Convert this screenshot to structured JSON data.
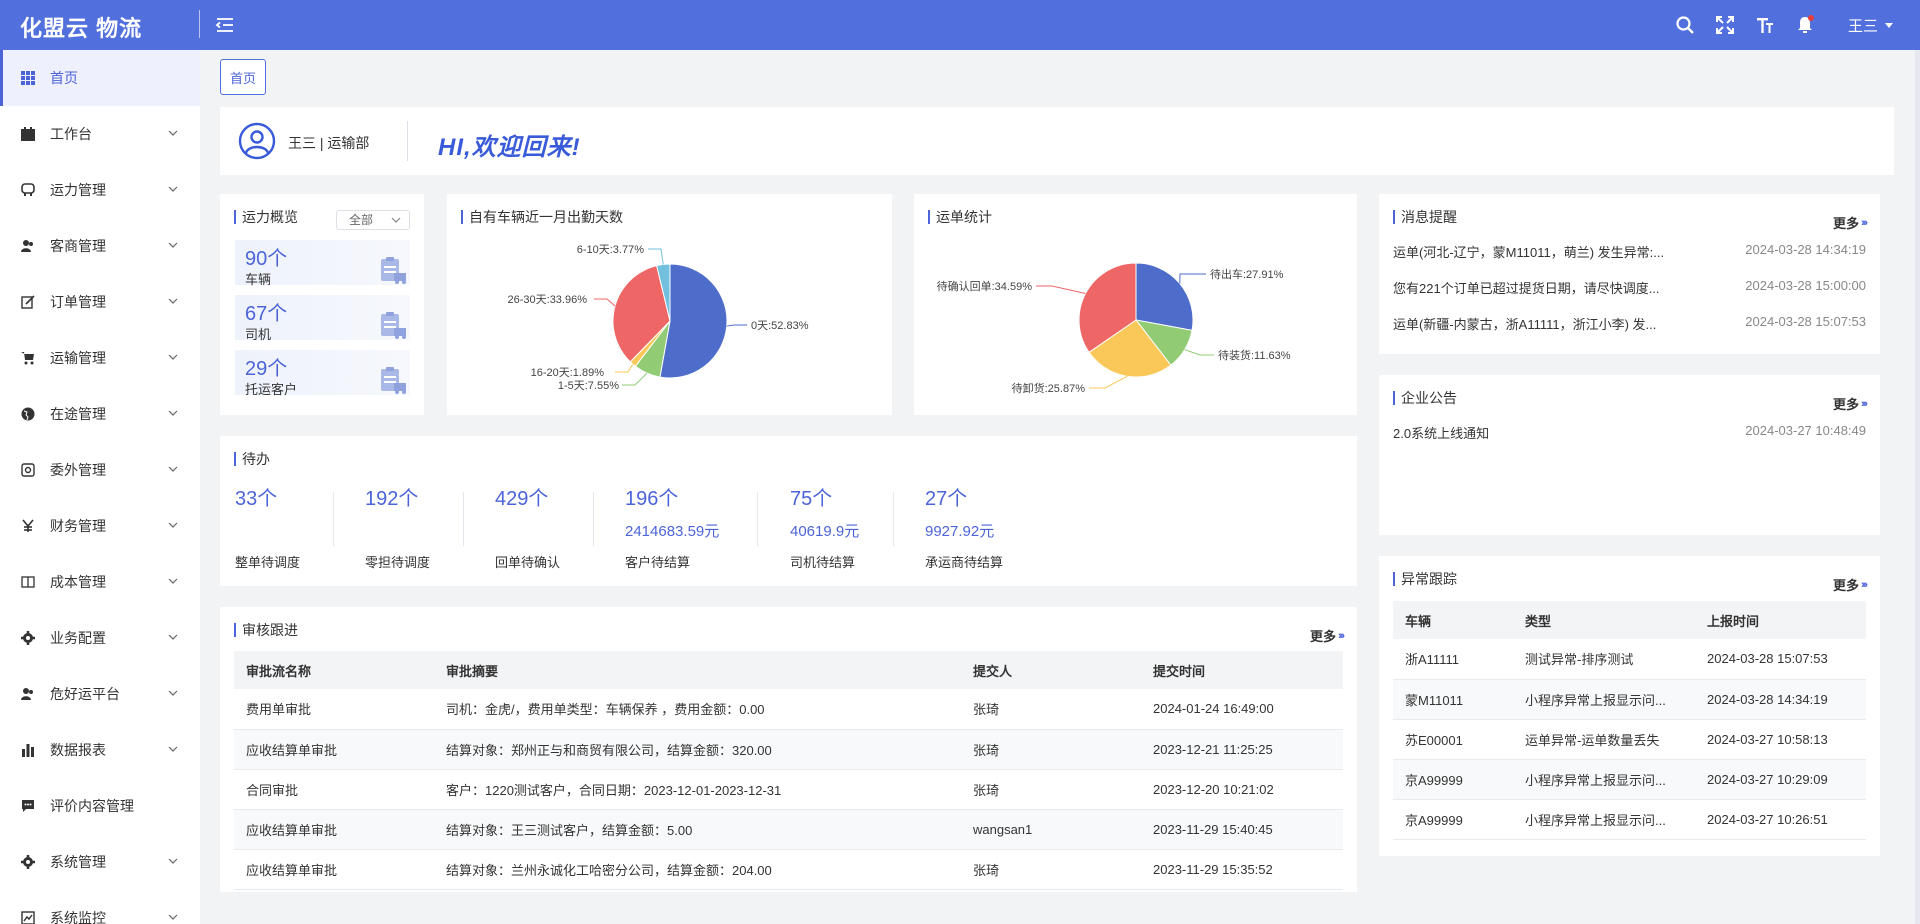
{
  "app": {
    "title": "化盟云 物流"
  },
  "header": {
    "user_name": "王三"
  },
  "sidebar": {
    "items": [
      {
        "label": "首页",
        "icon": "grid-icon"
      },
      {
        "label": "工作台",
        "icon": "calendar-icon"
      },
      {
        "label": "运力管理",
        "icon": "vehicle-icon"
      },
      {
        "label": "客商管理",
        "icon": "users-icon"
      },
      {
        "label": "订单管理",
        "icon": "edit-icon"
      },
      {
        "label": "运输管理",
        "icon": "cart-icon"
      },
      {
        "label": "在途管理",
        "icon": "globe-icon"
      },
      {
        "label": "委外管理",
        "icon": "outsource-icon"
      },
      {
        "label": "财务管理",
        "icon": "yen-icon"
      },
      {
        "label": "成本管理",
        "icon": "book-icon"
      },
      {
        "label": "业务配置",
        "icon": "gear-icon"
      },
      {
        "label": "危好运平台",
        "icon": "user-group-icon"
      },
      {
        "label": "数据报表",
        "icon": "bar-chart-icon"
      },
      {
        "label": "评价内容管理",
        "icon": "comment-icon"
      },
      {
        "label": "系统管理",
        "icon": "settings-icon"
      },
      {
        "label": "系统监控",
        "icon": "monitor-icon"
      }
    ]
  },
  "tabs": {
    "home": "首页"
  },
  "welcome": {
    "user": "王三 | 运输部",
    "greeting": "HI,欢迎回来!"
  },
  "capacity": {
    "title": "运力概览",
    "filter": "全部",
    "items": [
      {
        "value": "90个",
        "label": "车辆"
      },
      {
        "value": "67个",
        "label": "司机"
      },
      {
        "value": "29个",
        "label": "托运客户"
      }
    ]
  },
  "attendance": {
    "title": "自有车辆近一月出勤天数",
    "chart_data": {
      "type": "pie",
      "slices": [
        {
          "label": "0天:52.83%",
          "value": 52.83,
          "color": "#4e6cc9"
        },
        {
          "label": "1-5天:7.55%",
          "value": 7.55,
          "color": "#91cc75"
        },
        {
          "label": "16-20天:1.89%",
          "value": 1.89,
          "color": "#fac858"
        },
        {
          "label": "26-30天:33.96%",
          "value": 33.96,
          "color": "#ee6666"
        },
        {
          "label": "6-10天:3.77%",
          "value": 3.77,
          "color": "#73c0de"
        }
      ]
    }
  },
  "waybill": {
    "title": "运单统计",
    "chart_data": {
      "type": "pie",
      "slices": [
        {
          "label": "待出车:27.91%",
          "value": 27.91,
          "color": "#4e6cc9"
        },
        {
          "label": "待装货:11.63%",
          "value": 11.63,
          "color": "#91cc75"
        },
        {
          "label": "待卸货:25.87%",
          "value": 25.87,
          "color": "#fac858"
        },
        {
          "label": "待确认回单:34.59%",
          "value": 34.59,
          "color": "#ee6666"
        }
      ]
    }
  },
  "todo": {
    "title": "待办",
    "items": [
      {
        "count": "33个",
        "amount": "",
        "label": "整单待调度"
      },
      {
        "count": "192个",
        "amount": "",
        "label": "零担待调度"
      },
      {
        "count": "429个",
        "amount": "",
        "label": "回单待确认"
      },
      {
        "count": "196个",
        "amount": "2414683.59元",
        "label": "客户待结算"
      },
      {
        "count": "75个",
        "amount": "40619.9元",
        "label": "司机待结算"
      },
      {
        "count": "27个",
        "amount": "9927.92元",
        "label": "承运商待结算"
      }
    ]
  },
  "audit": {
    "title": "审核跟进",
    "more": "更多",
    "columns": [
      "审批流名称",
      "审批摘要",
      "提交人",
      "提交时间"
    ],
    "rows": [
      [
        "费用单审批",
        "司机：金虎/，费用单类型：车辆保养 ，费用金额：0.00",
        "张琦",
        "2024-01-24 16:49:00"
      ],
      [
        "应收结算单审批",
        "结算对象：郑州正与和商贸有限公司，结算金额：320.00",
        "张琦",
        "2023-12-21 11:25:25"
      ],
      [
        "合同审批",
        "客户：1220测试客户，合同日期：2023-12-01-2023-12-31",
        "张琦",
        "2023-12-20 10:21:02"
      ],
      [
        "应收结算单审批",
        "结算对象：王三测试客户，结算金额：5.00",
        "wangsan1",
        "2023-11-29 15:40:45"
      ],
      [
        "应收结算单审批",
        "结算对象：兰州永诚化工哈密分公司，结算金额：204.00",
        "张琦",
        "2023-11-29 15:35:52"
      ]
    ]
  },
  "messages": {
    "title": "消息提醒",
    "more": "更多",
    "items": [
      {
        "text": "运单(河北-辽宁，蒙M11011，萌兰) 发生异常:...",
        "time": "2024-03-28 14:34:19"
      },
      {
        "text": "您有221个订单已超过提货日期，请尽快调度...",
        "time": "2024-03-28 15:00:00"
      },
      {
        "text": "运单(新疆-内蒙古，浙A11111，浙江小李) 发...",
        "time": "2024-03-28 15:07:53"
      }
    ]
  },
  "notice": {
    "title": "企业公告",
    "more": "更多",
    "items": [
      {
        "text": "2.0系统上线通知",
        "time": "2024-03-27 10:48:49"
      }
    ]
  },
  "exceptions": {
    "title": "异常跟踪",
    "more": "更多",
    "columns": [
      "车辆",
      "类型",
      "上报时间"
    ],
    "rows": [
      [
        "浙A11111",
        "测试异常-排序测试",
        "2024-03-28 15:07:53"
      ],
      [
        "蒙M11011",
        "小程序异常上报显示问...",
        "2024-03-28 14:34:19"
      ],
      [
        "苏E00001",
        "运单异常-运单数量丢失",
        "2024-03-27 10:58:13"
      ],
      [
        "京A99999",
        "小程序异常上报显示问...",
        "2024-03-27 10:29:09"
      ],
      [
        "京A99999",
        "小程序异常上报显示问...",
        "2024-03-27 10:26:51"
      ]
    ]
  },
  "colors": {
    "primary": "#5170dd",
    "accent": "#4c64d8"
  }
}
